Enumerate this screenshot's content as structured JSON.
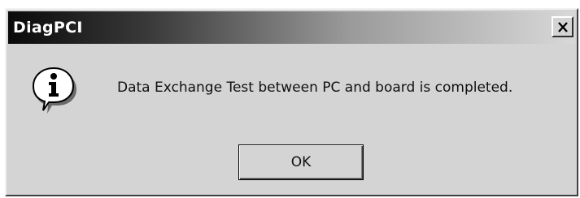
{
  "window": {
    "title": "DiagPCI",
    "close_icon": "close-icon"
  },
  "dialog": {
    "icon": "info-icon",
    "message": "Data Exchange Test between PC and board is completed."
  },
  "buttons": {
    "ok_label": "OK"
  },
  "colors": {
    "titlebar_start": "#0a0a0a",
    "titlebar_end": "#d8d8d8",
    "dialog_bg": "#d4d4d4"
  }
}
